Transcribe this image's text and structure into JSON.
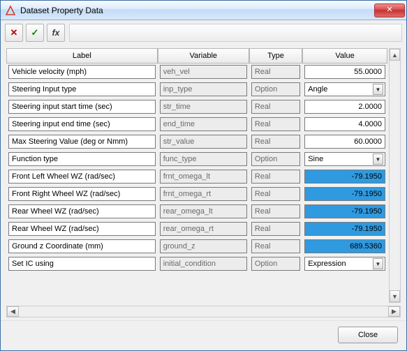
{
  "title": "Dataset Property Data",
  "toolbar": {
    "cancel_glyph": "✕",
    "accept_glyph": "✓",
    "fx_glyph": "fx"
  },
  "columns": {
    "label": "Label",
    "variable": "Variable",
    "type": "Type",
    "value": "Value"
  },
  "types": {
    "real": "Real",
    "option": "Option"
  },
  "rows": [
    {
      "label": "Vehicle velocity (mph)",
      "variable": "veh_vel",
      "type": "Real",
      "value": "55.0000",
      "vk": "num"
    },
    {
      "label": "Steering Input type",
      "variable": "inp_type",
      "type": "Option",
      "value": "Angle",
      "vk": "select"
    },
    {
      "label": "Steering input start time (sec)",
      "variable": "str_time",
      "type": "Real",
      "value": "2.0000",
      "vk": "num"
    },
    {
      "label": "Steering input end time (sec)",
      "variable": "end_time",
      "type": "Real",
      "value": "4.0000",
      "vk": "num"
    },
    {
      "label": "Max Steering Value (deg or Nmm)",
      "variable": "str_value",
      "type": "Real",
      "value": "60.0000",
      "vk": "num"
    },
    {
      "label": "Function type",
      "variable": "func_type",
      "type": "Option",
      "value": "Sine",
      "vk": "select"
    },
    {
      "label": "Front Left Wheel WZ (rad/sec)",
      "variable": "frnt_omega_lt",
      "type": "Real",
      "value": "-79.1950",
      "vk": "hl"
    },
    {
      "label": "Front Right Wheel WZ (rad/sec)",
      "variable": "frnt_omega_rt",
      "type": "Real",
      "value": "-79.1950",
      "vk": "hl"
    },
    {
      "label": "Rear Wheel WZ (rad/sec)",
      "variable": "rear_omega_lt",
      "type": "Real",
      "value": "-79.1950",
      "vk": "hl"
    },
    {
      "label": "Rear Wheel WZ (rad/sec)",
      "variable": "rear_omega_rt",
      "type": "Real",
      "value": "-79.1950",
      "vk": "hl"
    },
    {
      "label": "Ground z Coordinate (mm)",
      "variable": "ground_z",
      "type": "Real",
      "value": "689.5360",
      "vk": "hl"
    },
    {
      "label": "Set IC using",
      "variable": "initial_condition",
      "type": "Option",
      "value": "Expression",
      "vk": "select"
    }
  ],
  "footer": {
    "close_label": "Close"
  },
  "icons": {
    "close": "✕",
    "dropdown": "▼",
    "up": "▲",
    "down": "▼",
    "left": "◀",
    "right": "▶"
  },
  "col_widths": {
    "label": 210,
    "variable": 127,
    "type": 74,
    "value": 118
  }
}
